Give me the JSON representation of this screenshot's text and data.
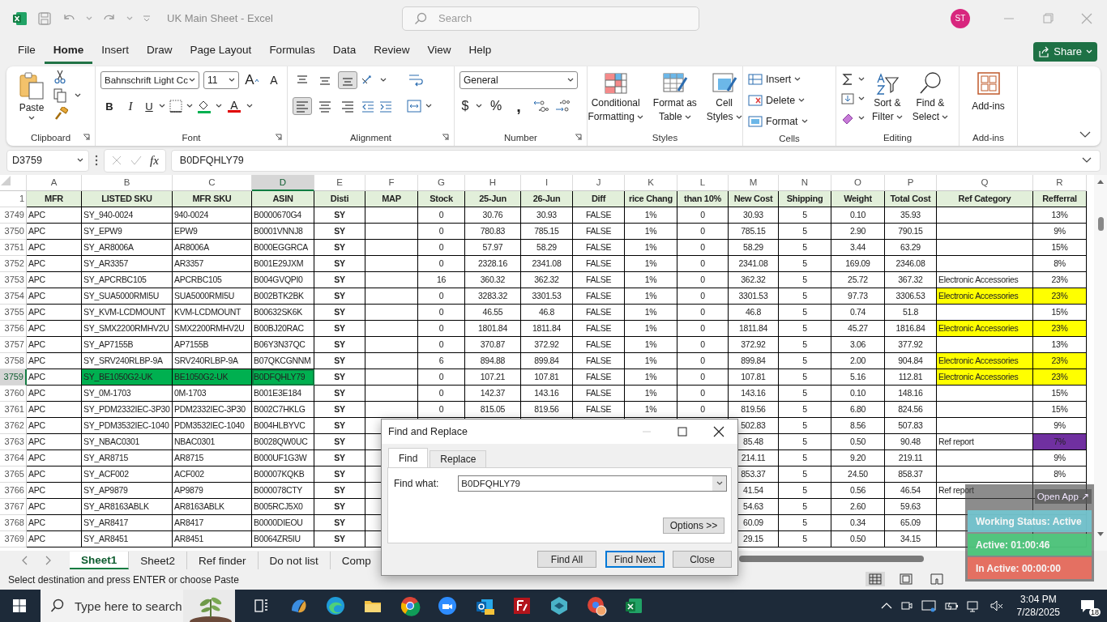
{
  "title_bar": {
    "title": "UK Main Sheet - Excel",
    "search_placeholder": "Search",
    "avatar": "ST"
  },
  "menu_tabs": [
    {
      "label": "File",
      "selected": false
    },
    {
      "label": "Home",
      "selected": true
    },
    {
      "label": "Insert",
      "selected": false
    },
    {
      "label": "Draw",
      "selected": false
    },
    {
      "label": "Page Layout",
      "selected": false
    },
    {
      "label": "Formulas",
      "selected": false
    },
    {
      "label": "Data",
      "selected": false
    },
    {
      "label": "Review",
      "selected": false
    },
    {
      "label": "View",
      "selected": false
    },
    {
      "label": "Help",
      "selected": false
    }
  ],
  "share": "Share",
  "ribbon": {
    "clipboard": {
      "paste": "Paste",
      "label": "Clipboard"
    },
    "font": {
      "name": "Bahnschrift Light Cc",
      "size": "11",
      "grow": "A",
      "shrink": "A",
      "bold": "B",
      "italic": "I",
      "underline": "U",
      "font_color": "A",
      "label": "Font"
    },
    "alignment": {
      "vertical": [
        {
          "selected": false
        },
        {
          "selected": false
        },
        {
          "selected": true
        }
      ],
      "horizontal": [
        {
          "selected": true
        },
        {
          "selected": false
        },
        {
          "selected": false
        }
      ],
      "label": "Alignment"
    },
    "number": {
      "format": "General",
      "currency": "$",
      "percent": "%",
      "comma": ",",
      "label": "Number"
    },
    "styles": {
      "buttons": [
        {
          "line1": "Conditional",
          "line2": "Formatting"
        },
        {
          "line1": "Format as",
          "line2": "Table"
        },
        {
          "line1": "Cell",
          "line2": "Styles"
        }
      ],
      "label": "Styles"
    },
    "cells": {
      "buttons": [
        "Insert",
        "Delete",
        "Format"
      ],
      "label": "Cells"
    },
    "editing": {
      "buttons": [
        {
          "line1": "Sort &",
          "line2": "Filter"
        },
        {
          "line1": "Find &",
          "line2": "Select"
        }
      ],
      "label": "Editing"
    },
    "addins": {
      "button": "Add-ins",
      "label": "Add-ins"
    }
  },
  "formula_bar": {
    "name_box": "D3759",
    "fx": "fx",
    "value": "B0DFQHLY79"
  },
  "sheet": {
    "columns": [
      {
        "letter": "A",
        "selected": false
      },
      {
        "letter": "B",
        "selected": false
      },
      {
        "letter": "C",
        "selected": false
      },
      {
        "letter": "D",
        "selected": true
      },
      {
        "letter": "E",
        "selected": false
      },
      {
        "letter": "F",
        "selected": false
      },
      {
        "letter": "G",
        "selected": false
      },
      {
        "letter": "H",
        "selected": false
      },
      {
        "letter": "I",
        "selected": false
      },
      {
        "letter": "J",
        "selected": false
      },
      {
        "letter": "K",
        "selected": false
      },
      {
        "letter": "L",
        "selected": false
      },
      {
        "letter": "M",
        "selected": false
      },
      {
        "letter": "N",
        "selected": false
      },
      {
        "letter": "O",
        "selected": false
      },
      {
        "letter": "P",
        "selected": false
      },
      {
        "letter": "Q",
        "selected": false
      },
      {
        "letter": "R",
        "selected": false
      }
    ],
    "header": {
      "n": "1",
      "A": "MFR",
      "B": "LISTED SKU",
      "C": "MFR SKU",
      "D": "ASIN",
      "E": "Disti",
      "F": "MAP",
      "G": "Stock",
      "H": "25-Jun",
      "I": "26-Jun",
      "J": "Diff",
      "K": "rice Chang",
      "L": "than 10%",
      "M": "New Cost",
      "N": "Shipping",
      "O": "Weight",
      "P": "Total Cost",
      "Q": "Ref Category",
      "R": "Refferral"
    },
    "rows": [
      {
        "n": "3749",
        "selected": false,
        "A": "APC",
        "B": "SY_940-0024",
        "C": "940-0024",
        "D": "B0000670G4",
        "E": "SY",
        "G": "0",
        "H": "30.76",
        "I": "30.93",
        "J": "FALSE",
        "K": "1%",
        "L": "0",
        "M": "30.93",
        "N": "5",
        "O": "0.10",
        "P": "35.93",
        "R": "13%"
      },
      {
        "n": "3750",
        "selected": false,
        "A": "APC",
        "B": "SY_EPW9",
        "C": "EPW9",
        "D": "B0001VNNJ8",
        "E": "SY",
        "G": "0",
        "H": "780.83",
        "I": "785.15",
        "J": "FALSE",
        "K": "1%",
        "L": "0",
        "M": "785.15",
        "N": "5",
        "O": "2.90",
        "P": "790.15",
        "R": "9%"
      },
      {
        "n": "3751",
        "selected": false,
        "A": "APC",
        "B": "SY_AR8006A",
        "C": "AR8006A",
        "D": "B000EGGRCA",
        "E": "SY",
        "G": "0",
        "H": "57.97",
        "I": "58.29",
        "J": "FALSE",
        "K": "1%",
        "L": "0",
        "M": "58.29",
        "N": "5",
        "O": "3.44",
        "P": "63.29",
        "R": "15%"
      },
      {
        "n": "3752",
        "selected": false,
        "A": "APC",
        "B": "SY_AR3357",
        "C": "AR3357",
        "D": "B001E29JXM",
        "E": "SY",
        "G": "0",
        "H": "2328.16",
        "I": "2341.08",
        "J": "FALSE",
        "K": "1%",
        "L": "0",
        "M": "2341.08",
        "N": "5",
        "O": "169.09",
        "P": "2346.08",
        "R": "8%"
      },
      {
        "n": "3753",
        "selected": false,
        "A": "APC",
        "B": "SY_APCRBC105",
        "C": "APCRBC105",
        "D": "B004GVQPI0",
        "E": "SY",
        "G": "16",
        "H": "360.32",
        "I": "362.32",
        "J": "FALSE",
        "K": "1%",
        "L": "0",
        "M": "362.32",
        "N": "5",
        "O": "25.72",
        "P": "367.32",
        "Q": "Electronic Accessories",
        "R": "23%"
      },
      {
        "n": "3754",
        "selected": false,
        "A": "APC",
        "B": "SY_SUA5000RMI5U",
        "C": "SUA5000RMI5U",
        "D": "B002BTK2BK",
        "E": "SY",
        "G": "0",
        "H": "3283.32",
        "I": "3301.53",
        "J": "FALSE",
        "K": "1%",
        "L": "0",
        "M": "3301.53",
        "N": "5",
        "O": "97.73",
        "P": "3306.53",
        "Q": "Electronic Accessories",
        "R": "23%",
        "fill": {
          "Q": {
            "color": "#ffff00"
          },
          "R": {
            "color": "#ffff00"
          }
        }
      },
      {
        "n": "3755",
        "selected": false,
        "A": "APC",
        "B": "SY_KVM-LCDMOUNT",
        "C": "KVM-LCDMOUNT",
        "D": "B00632SK6K",
        "E": "SY",
        "G": "0",
        "H": "46.55",
        "I": "46.8",
        "J": "FALSE",
        "K": "1%",
        "L": "0",
        "M": "46.8",
        "N": "5",
        "O": "0.74",
        "P": "51.8",
        "R": "15%"
      },
      {
        "n": "3756",
        "selected": false,
        "A": "APC",
        "B": "SY_SMX2200RMHV2U",
        "C": "SMX2200RMHV2U",
        "D": "B00BJ20RAC",
        "E": "SY",
        "G": "0",
        "H": "1801.84",
        "I": "1811.84",
        "J": "FALSE",
        "K": "1%",
        "L": "0",
        "M": "1811.84",
        "N": "5",
        "O": "45.27",
        "P": "1816.84",
        "Q": "Electronic Accessories",
        "R": "23%",
        "fill": {
          "Q": {
            "color": "#ffff00"
          },
          "R": {
            "color": "#ffff00"
          }
        }
      },
      {
        "n": "3757",
        "selected": false,
        "A": "APC",
        "B": "SY_AP7155B",
        "C": "AP7155B",
        "D": "B06Y3N37QC",
        "E": "SY",
        "G": "0",
        "H": "370.87",
        "I": "372.92",
        "J": "FALSE",
        "K": "1%",
        "L": "0",
        "M": "372.92",
        "N": "5",
        "O": "3.06",
        "P": "377.92",
        "R": "13%"
      },
      {
        "n": "3758",
        "selected": false,
        "A": "APC",
        "B": "SY_SRV240RLBP-9A",
        "C": "SRV240RLBP-9A",
        "D": "B07QKCGNNM",
        "E": "SY",
        "G": "6",
        "H": "894.88",
        "I": "899.84",
        "J": "FALSE",
        "K": "1%",
        "L": "0",
        "M": "899.84",
        "N": "5",
        "O": "2.00",
        "P": "904.84",
        "Q": "Electronic Accessories",
        "R": "23%",
        "fill": {
          "Q": {
            "color": "#ffff00"
          },
          "R": {
            "color": "#ffff00"
          }
        }
      },
      {
        "n": "3759",
        "selected": true,
        "A": "APC",
        "B": "SY_BE1050G2-UK",
        "C": "BE1050G2-UK",
        "D": "B0DFQHLY79",
        "E": "SY",
        "G": "0",
        "H": "107.21",
        "I": "107.81",
        "J": "FALSE",
        "K": "1%",
        "L": "0",
        "M": "107.81",
        "N": "5",
        "O": "5.16",
        "P": "112.81",
        "Q": "Electronic Accessories",
        "R": "23%",
        "fill": {
          "B": {
            "color": "#00b050"
          },
          "C": {
            "color": "#00b050"
          },
          "D": {
            "color": "#00b050"
          },
          "Q": {
            "color": "#ffff00"
          },
          "R": {
            "color": "#ffff00"
          }
        }
      },
      {
        "n": "3760",
        "selected": false,
        "A": "APC",
        "B": "SY_0M-1703",
        "C": "0M-1703",
        "D": "B001E3E184",
        "E": "SY",
        "G": "0",
        "H": "142.37",
        "I": "143.16",
        "J": "FALSE",
        "K": "1%",
        "L": "0",
        "M": "143.16",
        "N": "5",
        "O": "0.10",
        "P": "148.16",
        "R": "15%"
      },
      {
        "n": "3761",
        "selected": false,
        "A": "APC",
        "B": "SY_PDM2332IEC-3P30",
        "C": "PDM2332IEC-3P30",
        "D": "B002C7HKLG",
        "E": "SY",
        "G": "0",
        "H": "815.05",
        "I": "819.56",
        "J": "FALSE",
        "K": "1%",
        "L": "0",
        "M": "819.56",
        "N": "5",
        "O": "6.80",
        "P": "824.56",
        "R": "15%"
      },
      {
        "n": "3762",
        "selected": false,
        "A": "APC",
        "B": "SY_PDM3532IEC-1040",
        "C": "PDM3532IEC-1040",
        "D": "B004HLBYVC",
        "E": "SY",
        "M": "502.83",
        "N": "5",
        "O": "8.56",
        "P": "507.83",
        "R": "9%"
      },
      {
        "n": "3763",
        "selected": false,
        "A": "APC",
        "B": "SY_NBAC0301",
        "C": "NBAC0301",
        "D": "B0028QW0UC",
        "E": "SY",
        "M": "85.48",
        "N": "5",
        "O": "0.50",
        "P": "90.48",
        "Q": "Ref report",
        "R": "7%",
        "fill": {
          "R": {
            "color": "#7030a0"
          }
        }
      },
      {
        "n": "3764",
        "selected": false,
        "A": "APC",
        "B": "SY_AR8715",
        "C": "AR8715",
        "D": "B000UF1G3W",
        "E": "SY",
        "M": "214.11",
        "N": "5",
        "O": "9.20",
        "P": "219.11",
        "R": "9%"
      },
      {
        "n": "3765",
        "selected": false,
        "A": "APC",
        "B": "SY_ACF002",
        "C": "ACF002",
        "D": "B00007KQKB",
        "E": "SY",
        "M": "853.37",
        "N": "5",
        "O": "24.50",
        "P": "858.37",
        "R": "8%"
      },
      {
        "n": "3766",
        "selected": false,
        "A": "APC",
        "B": "SY_AP9879",
        "C": "AP9879",
        "D": "B000078CTY",
        "E": "SY",
        "M": "41.54",
        "N": "5",
        "O": "0.56",
        "P": "46.54",
        "Q": "Ref report"
      },
      {
        "n": "3767",
        "selected": false,
        "A": "APC",
        "B": "SY_AR8163ABLK",
        "C": "AR8163ABLK",
        "D": "B005RCJ5X0",
        "E": "SY",
        "M": "54.63",
        "N": "5",
        "O": "2.60",
        "P": "59.63"
      },
      {
        "n": "3768",
        "selected": false,
        "A": "APC",
        "B": "SY_AR8417",
        "C": "AR8417",
        "D": "B0000DIEOU",
        "E": "SY",
        "M": "60.09",
        "N": "5",
        "O": "0.34",
        "P": "65.09"
      },
      {
        "n": "3769",
        "selected": false,
        "A": "APC",
        "B": "SY_AR8451",
        "C": "AR8451",
        "D": "B0064ZR5IU",
        "E": "SY",
        "M": "29.15",
        "N": "5",
        "O": "0.50",
        "P": "34.15"
      }
    ]
  },
  "sheet_tabs": [
    {
      "label": "Sheet1",
      "selected": true
    },
    {
      "label": "Sheet2",
      "selected": false
    },
    {
      "label": "Ref finder",
      "selected": false
    },
    {
      "label": "Do not list",
      "selected": false
    },
    {
      "label": "Comp",
      "selected": false
    }
  ],
  "status": "Select destination and press ENTER or choose Paste",
  "dialog": {
    "title": "Find and Replace",
    "tabs": [
      {
        "label": "Find",
        "selected": true
      },
      {
        "label": "Replace",
        "selected": false
      }
    ],
    "find_label": "Find what:",
    "find_value": "B0DFQHLY79",
    "options": "Options >>",
    "buttons": [
      {
        "label": "Find All",
        "default": false
      },
      {
        "label": "Find Next",
        "default": true
      },
      {
        "label": "Close",
        "default": false
      }
    ]
  },
  "tracker": {
    "open_app": "Open App ↗",
    "items": [
      {
        "label": "Working Status: Active",
        "color": "#74c6d0"
      },
      {
        "label": "Active: 01:00:46",
        "color": "#4ec97d"
      },
      {
        "label": "In Active: 00:00:00",
        "color": "#ec6f60"
      }
    ]
  },
  "taskbar": {
    "search_placeholder": "Type here to search",
    "time": "3:04 PM",
    "date": "7/28/2025",
    "notifications": "18"
  }
}
